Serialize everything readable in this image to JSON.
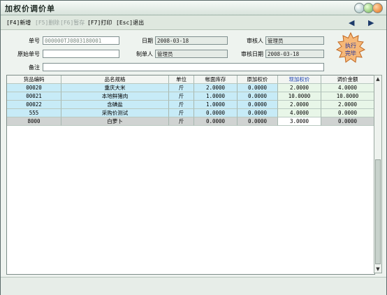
{
  "window": {
    "title": "加权价调价单"
  },
  "toolbar": {
    "items": [
      "[F4]新增",
      "[F5]删除",
      "[F6]暂存",
      "[F7]打印",
      "[Esc]退出"
    ],
    "prev_icon": "arrow-left-icon",
    "next_icon": "arrow-right-icon"
  },
  "form": {
    "order_no_label": "单号",
    "order_no": "000000TJ0803180001",
    "date_label": "日期",
    "date": "2008-03-18",
    "auditor_label": "审核人",
    "auditor": "管理员",
    "orig_no_label": "原始单号",
    "orig_no": "",
    "maker_label": "制单人",
    "maker": "管理员",
    "audit_date_label": "审核日期",
    "audit_date": "2008-03-18",
    "remark_label": "备注",
    "remark": ""
  },
  "stamp": {
    "line1": "执行",
    "line2": "完毕"
  },
  "table": {
    "columns": [
      "货品编码",
      "品名规格",
      "单位",
      "帐面库存",
      "原加权价",
      "现加权价",
      "调价金额"
    ],
    "rows": [
      [
        "00020",
        "重庆大米",
        "斤",
        "2.0000",
        "0.0000",
        "2.0000",
        "4.0000"
      ],
      [
        "00021",
        "本地鲜猪肉",
        "斤",
        "1.0000",
        "0.0000",
        "10.0000",
        "10.0000"
      ],
      [
        "00022",
        "含碘盐",
        "斤",
        "1.0000",
        "0.0000",
        "2.0000",
        "2.0000"
      ],
      [
        "555",
        "采购价测试",
        "斤",
        "0.0000",
        "0.0000",
        "4.0000",
        "0.0000"
      ],
      [
        "8000",
        "白萝卜",
        "斤",
        "0.0000",
        "0.0000",
        "3.0000",
        "0.0000"
      ]
    ]
  },
  "colors": {
    "row_blue": "#c7ebf7",
    "row_selected": "#d0d3d2",
    "editable_col": "#e8f6e8",
    "header_blue": "#1a3fb0"
  }
}
